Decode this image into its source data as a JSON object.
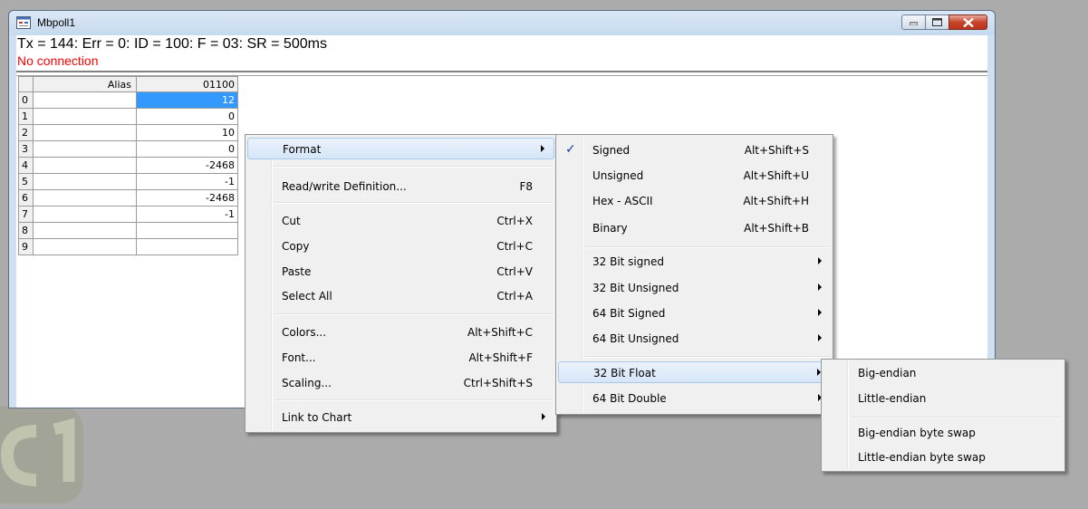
{
  "window": {
    "title": "Mbpoll1",
    "status_line": "Tx = 144: Err = 0: ID = 100: F = 03: SR = 500ms",
    "connection_status": "No connection"
  },
  "grid": {
    "headers": [
      "",
      "Alias",
      "01100"
    ],
    "rows": [
      {
        "index": "0",
        "alias": "",
        "value": "12"
      },
      {
        "index": "1",
        "alias": "",
        "value": "0"
      },
      {
        "index": "2",
        "alias": "",
        "value": "10"
      },
      {
        "index": "3",
        "alias": "",
        "value": "0"
      },
      {
        "index": "4",
        "alias": "",
        "value": "-2468"
      },
      {
        "index": "5",
        "alias": "",
        "value": "-1"
      },
      {
        "index": "6",
        "alias": "",
        "value": "-2468"
      },
      {
        "index": "7",
        "alias": "",
        "value": "-1"
      },
      {
        "index": "8",
        "alias": "",
        "value": ""
      },
      {
        "index": "9",
        "alias": "",
        "value": ""
      }
    ]
  },
  "context_menu": {
    "format": "Format",
    "read_write_definition": "Read/write Definition...",
    "read_write_definition_shortcut": "F8",
    "cut": "Cut",
    "cut_shortcut": "Ctrl+X",
    "copy": "Copy",
    "copy_shortcut": "Ctrl+C",
    "paste": "Paste",
    "paste_shortcut": "Ctrl+V",
    "select_all": "Select All",
    "select_all_shortcut": "Ctrl+A",
    "colors": "Colors...",
    "colors_shortcut": "Alt+Shift+C",
    "font": "Font...",
    "font_shortcut": "Alt+Shift+F",
    "scaling": "Scaling...",
    "scaling_shortcut": "Ctrl+Shift+S",
    "link_to_chart": "Link to Chart"
  },
  "format_menu": {
    "check_mark": "✓",
    "signed": "Signed",
    "signed_shortcut": "Alt+Shift+S",
    "unsigned": "Unsigned",
    "unsigned_shortcut": "Alt+Shift+U",
    "hex_ascii": "Hex - ASCII",
    "hex_ascii_shortcut": "Alt+Shift+H",
    "binary": "Binary",
    "binary_shortcut": "Alt+Shift+B",
    "bit32_signed": "32 Bit signed",
    "bit32_unsigned": "32 Bit Unsigned",
    "bit64_signed": "64 Bit Signed",
    "bit64_unsigned": "64 Bit Unsigned",
    "bit32_float": "32 Bit Float",
    "bit64_double": "64 Bit Double"
  },
  "float_menu": {
    "big_endian": "Big-endian",
    "little_endian": "Little-endian",
    "big_endian_byte_swap": "Big-endian byte swap",
    "little_endian_byte_swap": "Little-endian byte swap"
  },
  "colors": {
    "desktop": "#ababab",
    "selection": "#3399ff",
    "error_text": "#ff0000"
  }
}
